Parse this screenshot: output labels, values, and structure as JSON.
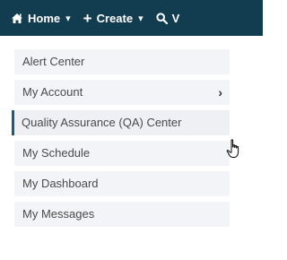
{
  "topbar": {
    "home_label": "Home",
    "home_caret": "▾",
    "create_label": "Create",
    "create_caret": "▾",
    "view_label": "V",
    "plus_glyph": "+",
    "colors": {
      "background": "#123d51",
      "text": "#ffffff"
    },
    "icons": {
      "home": "home-icon",
      "create": "plus-icon",
      "view": "search-icon"
    }
  },
  "menu": {
    "items": [
      {
        "label": "Alert Center"
      },
      {
        "label": "My Account",
        "chevron": "›"
      },
      {
        "label": "Quality Assurance (QA) Center",
        "hovered": true
      },
      {
        "label": "My Schedule"
      },
      {
        "label": "My Dashboard"
      },
      {
        "label": "My Messages"
      }
    ],
    "colors": {
      "item_background": "#f2f4f7",
      "hover_accent": "#1f5b79",
      "text": "#4a4a4a"
    }
  },
  "cursor": {
    "icon": "hand-pointer-icon"
  }
}
